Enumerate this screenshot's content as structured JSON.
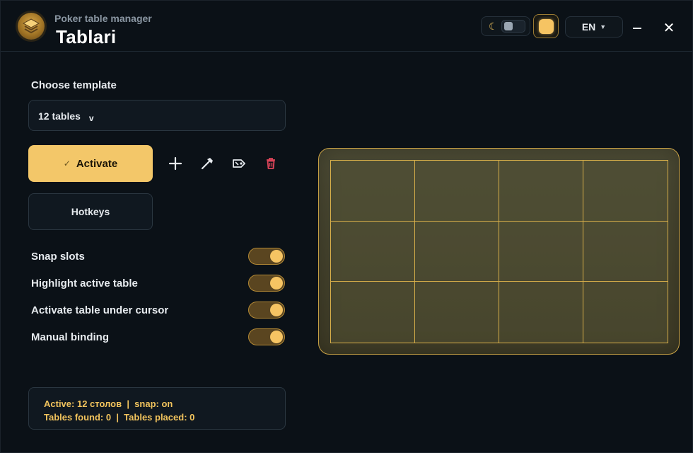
{
  "header": {
    "subtitle": "Poker table manager",
    "title": "Tablari",
    "language": "EN",
    "close_glyph": "✕",
    "moon_glyph": "☾"
  },
  "template": {
    "label": "Choose template",
    "selected": "12 tables",
    "chevron": "v"
  },
  "actions": {
    "activate_label": "Activate",
    "check_glyph": "✓",
    "hotkeys_label": "Hotkeys",
    "icons": [
      "plus-icon",
      "hammer-icon",
      "tag-icon",
      "trash-icon"
    ]
  },
  "toggles": [
    {
      "label": "Snap slots",
      "on": true
    },
    {
      "label": "Highlight active table",
      "on": true
    },
    {
      "label": "Activate table under cursor",
      "on": true
    },
    {
      "label": "Manual binding",
      "on": true
    }
  ],
  "status": {
    "line1": "Active: 12 столов  |  snap: on",
    "line2": "Tables found: 0  |  Tables placed: 0"
  },
  "preview": {
    "rows": 3,
    "cols": 4
  },
  "colors": {
    "accent": "#f3c769",
    "background": "#0b1117",
    "danger": "#e0455a"
  }
}
